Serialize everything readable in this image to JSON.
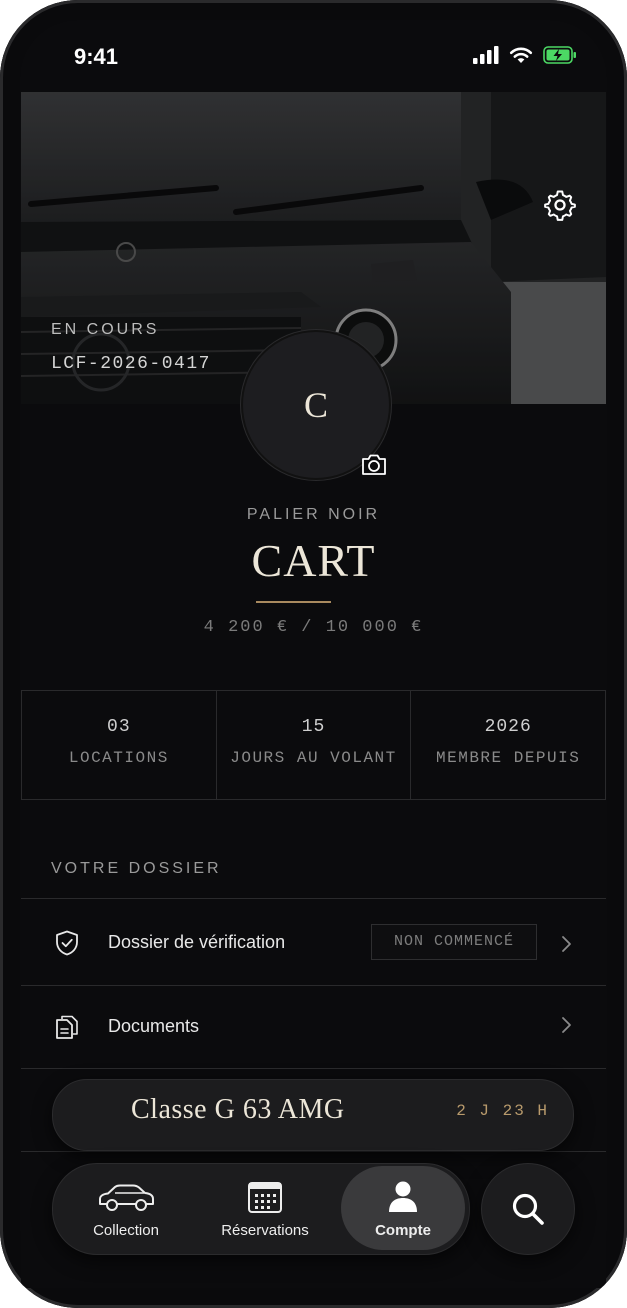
{
  "status_bar": {
    "time": "9:41"
  },
  "hero": {
    "status": "EN COURS",
    "reference": "LCF-2026-0417"
  },
  "profile": {
    "avatar_initial": "C",
    "tier": "PALIER NOIR",
    "name": "CART",
    "points": "4 200 € / 10 000 €"
  },
  "stats": [
    {
      "value": "03",
      "label": "LOCATIONS"
    },
    {
      "value": "15",
      "label": "JOURS AU VOLANT"
    },
    {
      "value": "2026",
      "label": "MEMBRE DEPUIS"
    }
  ],
  "dossier": {
    "title": "VOTRE DOSSIER",
    "items": [
      {
        "label": "Dossier de vérification",
        "status": "NON COMMENCÉ",
        "icon": "shield-check-icon"
      },
      {
        "label": "Documents",
        "icon": "documents-icon"
      }
    ]
  },
  "active_trip": {
    "model": "Classe G 63 AMG",
    "countdown": "2 J 23 H"
  },
  "tabbar": {
    "tabs": [
      {
        "label": "Collection",
        "icon": "car-icon"
      },
      {
        "label": "Réservations",
        "icon": "calendar-icon"
      },
      {
        "label": "Compte",
        "icon": "person-icon",
        "active": true
      }
    ],
    "search_icon": "search-icon"
  },
  "colors": {
    "background": "#0b0b0d",
    "accent_gold": "#b89a6c",
    "cream": "#ece6d8",
    "battery_green": "#4cd964"
  }
}
